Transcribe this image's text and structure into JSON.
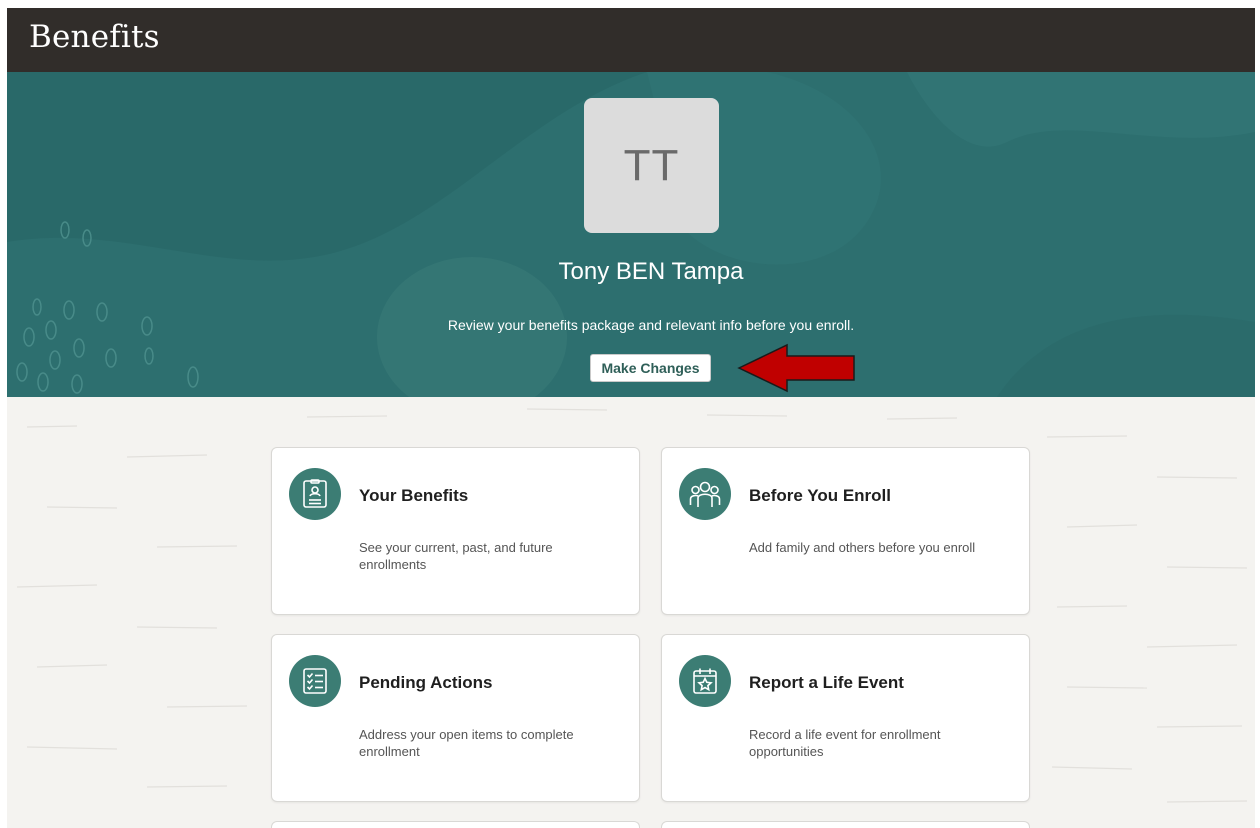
{
  "header": {
    "title": "Benefits"
  },
  "hero": {
    "avatar_initials": "TT",
    "user_name": "Tony BEN Tampa",
    "subtitle": "Review your benefits package and relevant info before you enroll.",
    "make_changes_label": "Make Changes"
  },
  "cards": [
    {
      "title": "Your Benefits",
      "description": "See your current, past, and future enrollments",
      "icon": "id-badge-icon"
    },
    {
      "title": "Before You Enroll",
      "description": "Add family and others before you enroll",
      "icon": "people-group-icon"
    },
    {
      "title": "Pending Actions",
      "description": "Address your open items to complete enrollment",
      "icon": "checklist-icon"
    },
    {
      "title": "Report a Life Event",
      "description": "Record a life event for enrollment opportunities",
      "icon": "calendar-star-icon"
    }
  ],
  "colors": {
    "header_bg": "#312d2a",
    "hero_bg": "#2d6f6f",
    "icon_bg": "#3c7d74",
    "annotation_arrow": "#c00000"
  }
}
